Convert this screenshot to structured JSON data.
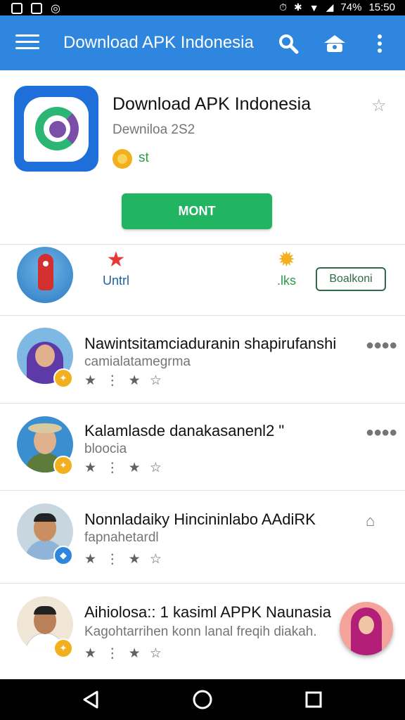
{
  "status_bar": {
    "battery": "74%",
    "time": "15:50"
  },
  "app_bar": {
    "title": "Download APK Indonesia"
  },
  "app": {
    "title": "Download APK Indonesia",
    "subtitle": "Dewniloa 2S2",
    "badge_label": "st",
    "install_label": "MONT"
  },
  "shortcuts": [
    {
      "label": "Untrl"
    },
    {
      "label": ".lks"
    },
    {
      "label": "Boalkoni"
    }
  ],
  "rows": [
    {
      "name": "Nawintsitamciaduranin shapirufanshi",
      "sub": "camialatamegrma",
      "stars": "★ ⋮ ★  ☆"
    },
    {
      "name": "Kalamlasde danakasanenl2 \"",
      "sub": "bloocia",
      "stars": "★ ⋮ ★  ☆"
    },
    {
      "name": "Nonnladaiky Hincininlabo AAdiRK",
      "sub": "fapnahetardl",
      "stars": "★ ⋮ ★  ☆"
    },
    {
      "name": "Aihiolosa:: 1 kasiml APPK Naunasia",
      "sub": "Kagohtarrihen konn lanal  freqih diakah.",
      "stars": "★ ⋮ ★  ☆"
    }
  ],
  "colors": {
    "app_bar": "#2e86de",
    "install": "#21b562",
    "badge": "#f2b01e"
  }
}
